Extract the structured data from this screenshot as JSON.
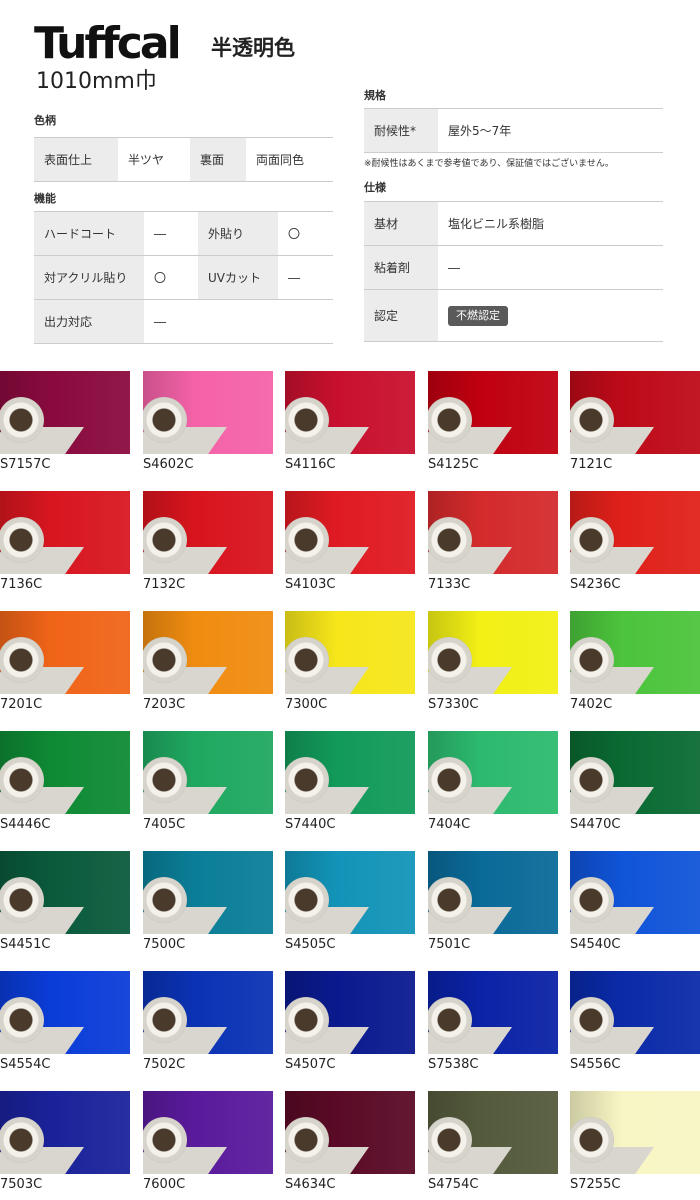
{
  "header": {
    "brand": "Tuffcal",
    "subtitle": "半透明色",
    "width": "1010mm巾"
  },
  "pattern": {
    "label": "色柄",
    "rows": [
      {
        "k1": "表面仕上",
        "v1": "半ツヤ",
        "k2": "裏面",
        "v2": "両面同色"
      }
    ]
  },
  "function": {
    "label": "機能",
    "rows": [
      {
        "k1": "ハードコート",
        "v1": "―",
        "k2": "外貼り",
        "v2": "〇"
      },
      {
        "k1": "対アクリル貼り",
        "v1": "〇",
        "k2": "UVカット",
        "v2": "―"
      },
      {
        "k1": "出力対応",
        "v1": "―",
        "k2": "",
        "v2": ""
      }
    ]
  },
  "standard": {
    "label": "規格",
    "rows": [
      {
        "k": "耐候性*",
        "v": "屋外5～7年"
      }
    ],
    "note": "※耐候性はあくまで参考値であり、保証値ではございません。"
  },
  "spec": {
    "label": "仕様",
    "rows": [
      {
        "k": "基材",
        "v": "塩化ビニル系樹脂"
      },
      {
        "k": "粘着剤",
        "v": "―"
      },
      {
        "k": "認定",
        "badge": "不燃認定"
      }
    ]
  },
  "swatches": [
    {
      "code": "S7157C",
      "color": "#8a0a3e"
    },
    {
      "code": "S4602C",
      "color": "#f562a8"
    },
    {
      "code": "S4116C",
      "color": "#c8102e"
    },
    {
      "code": "S4125C",
      "color": "#c00010"
    },
    {
      "code": "7121C",
      "color": "#be0a18"
    },
    {
      "code": "7136C",
      "color": "#d81620"
    },
    {
      "code": "7132C",
      "color": "#d8141e"
    },
    {
      "code": "S4103C",
      "color": "#e01a22"
    },
    {
      "code": "7133C",
      "color": "#d42a2c"
    },
    {
      "code": "S4236C",
      "color": "#e0201a"
    },
    {
      "code": "7201C",
      "color": "#f06418"
    },
    {
      "code": "7203C",
      "color": "#f08c10"
    },
    {
      "code": "7300C",
      "color": "#f6e61a"
    },
    {
      "code": "S7330C",
      "color": "#f2f014"
    },
    {
      "code": "7402C",
      "color": "#4cc43c"
    },
    {
      "code": "S4446C",
      "color": "#0e8a34"
    },
    {
      "code": "7405C",
      "color": "#1fa860"
    },
    {
      "code": "S7440C",
      "color": "#129a5a"
    },
    {
      "code": "7404C",
      "color": "#2cba6e"
    },
    {
      "code": "S4470C",
      "color": "#0a6a32"
    },
    {
      "code": "S4451C",
      "color": "#0a5a3c"
    },
    {
      "code": "7500C",
      "color": "#0a7e98"
    },
    {
      "code": "S4505C",
      "color": "#1294b8"
    },
    {
      "code": "7501C",
      "color": "#0a6a98"
    },
    {
      "code": "S4540C",
      "color": "#1054d8"
    },
    {
      "code": "S4554C",
      "color": "#0a3cd8"
    },
    {
      "code": "7502C",
      "color": "#0a32b4"
    },
    {
      "code": "S4507C",
      "color": "#0a1a8e"
    },
    {
      "code": "S7538C",
      "color": "#0a22a6"
    },
    {
      "code": "S4556C",
      "color": "#0a2aa8"
    },
    {
      "code": "7503C",
      "color": "#1a229a"
    },
    {
      "code": "7600C",
      "color": "#5a1a9c"
    },
    {
      "code": "S4634C",
      "color": "#5a0a26"
    },
    {
      "code": "S4754C",
      "color": "#545a3c"
    },
    {
      "code": "S7255C",
      "color": "#f8f6c4"
    }
  ]
}
